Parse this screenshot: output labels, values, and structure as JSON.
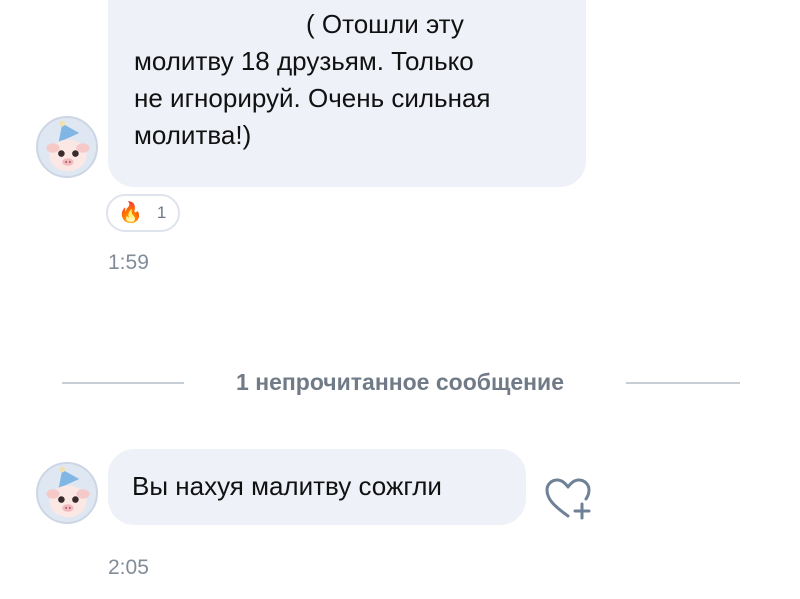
{
  "messages": [
    {
      "lines": [
        "( Отошли эту",
        "молитву 18 друзьям. Только",
        "не игнорируй. Очень сильная",
        "молитва!)"
      ],
      "reaction": {
        "icon": "fire-icon",
        "emoji": "🔥",
        "count": "1"
      },
      "time": "1:59"
    },
    {
      "text": "Вы нахуя малитву сожгли",
      "time": "2:05"
    }
  ],
  "divider": {
    "label": "1 непрочитанное сообщение"
  },
  "icons": {
    "avatar": "pig-avatar-icon",
    "react": "heart-plus-icon"
  },
  "colors": {
    "bubble": "#eef1f7",
    "divider_text": "#707b87",
    "time": "#818c99",
    "icon": "#6f8196"
  }
}
